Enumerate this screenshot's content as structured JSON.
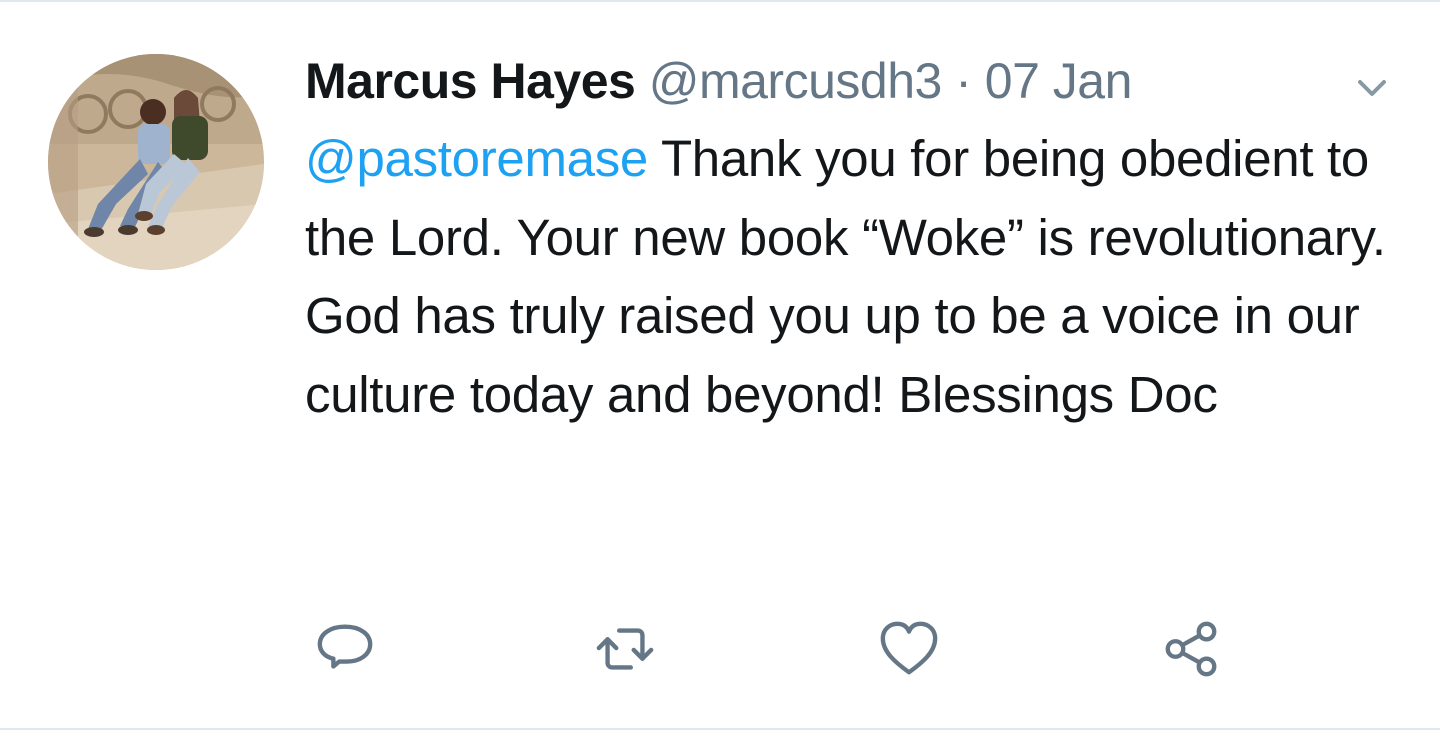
{
  "tweet": {
    "author_name": "Marcus Hayes",
    "handle": "@marcusdh3",
    "separator": "·",
    "date": "07 Jan",
    "mention": "@pastoremase",
    "body": "Thank you for being obedient to the Lord. Your new book “Woke” is revolutionary. God has truly raised you up to be a voice in our culture today and beyond! Blessings Doc"
  },
  "icons": {
    "caret": "chevron-down-icon",
    "reply": "reply-icon",
    "retweet": "retweet-icon",
    "like": "heart-icon",
    "share": "share-icon"
  },
  "colors": {
    "mention": "#1da1f2",
    "text": "#14171a",
    "secondary": "#657786",
    "divider": "#e1e8ed"
  }
}
